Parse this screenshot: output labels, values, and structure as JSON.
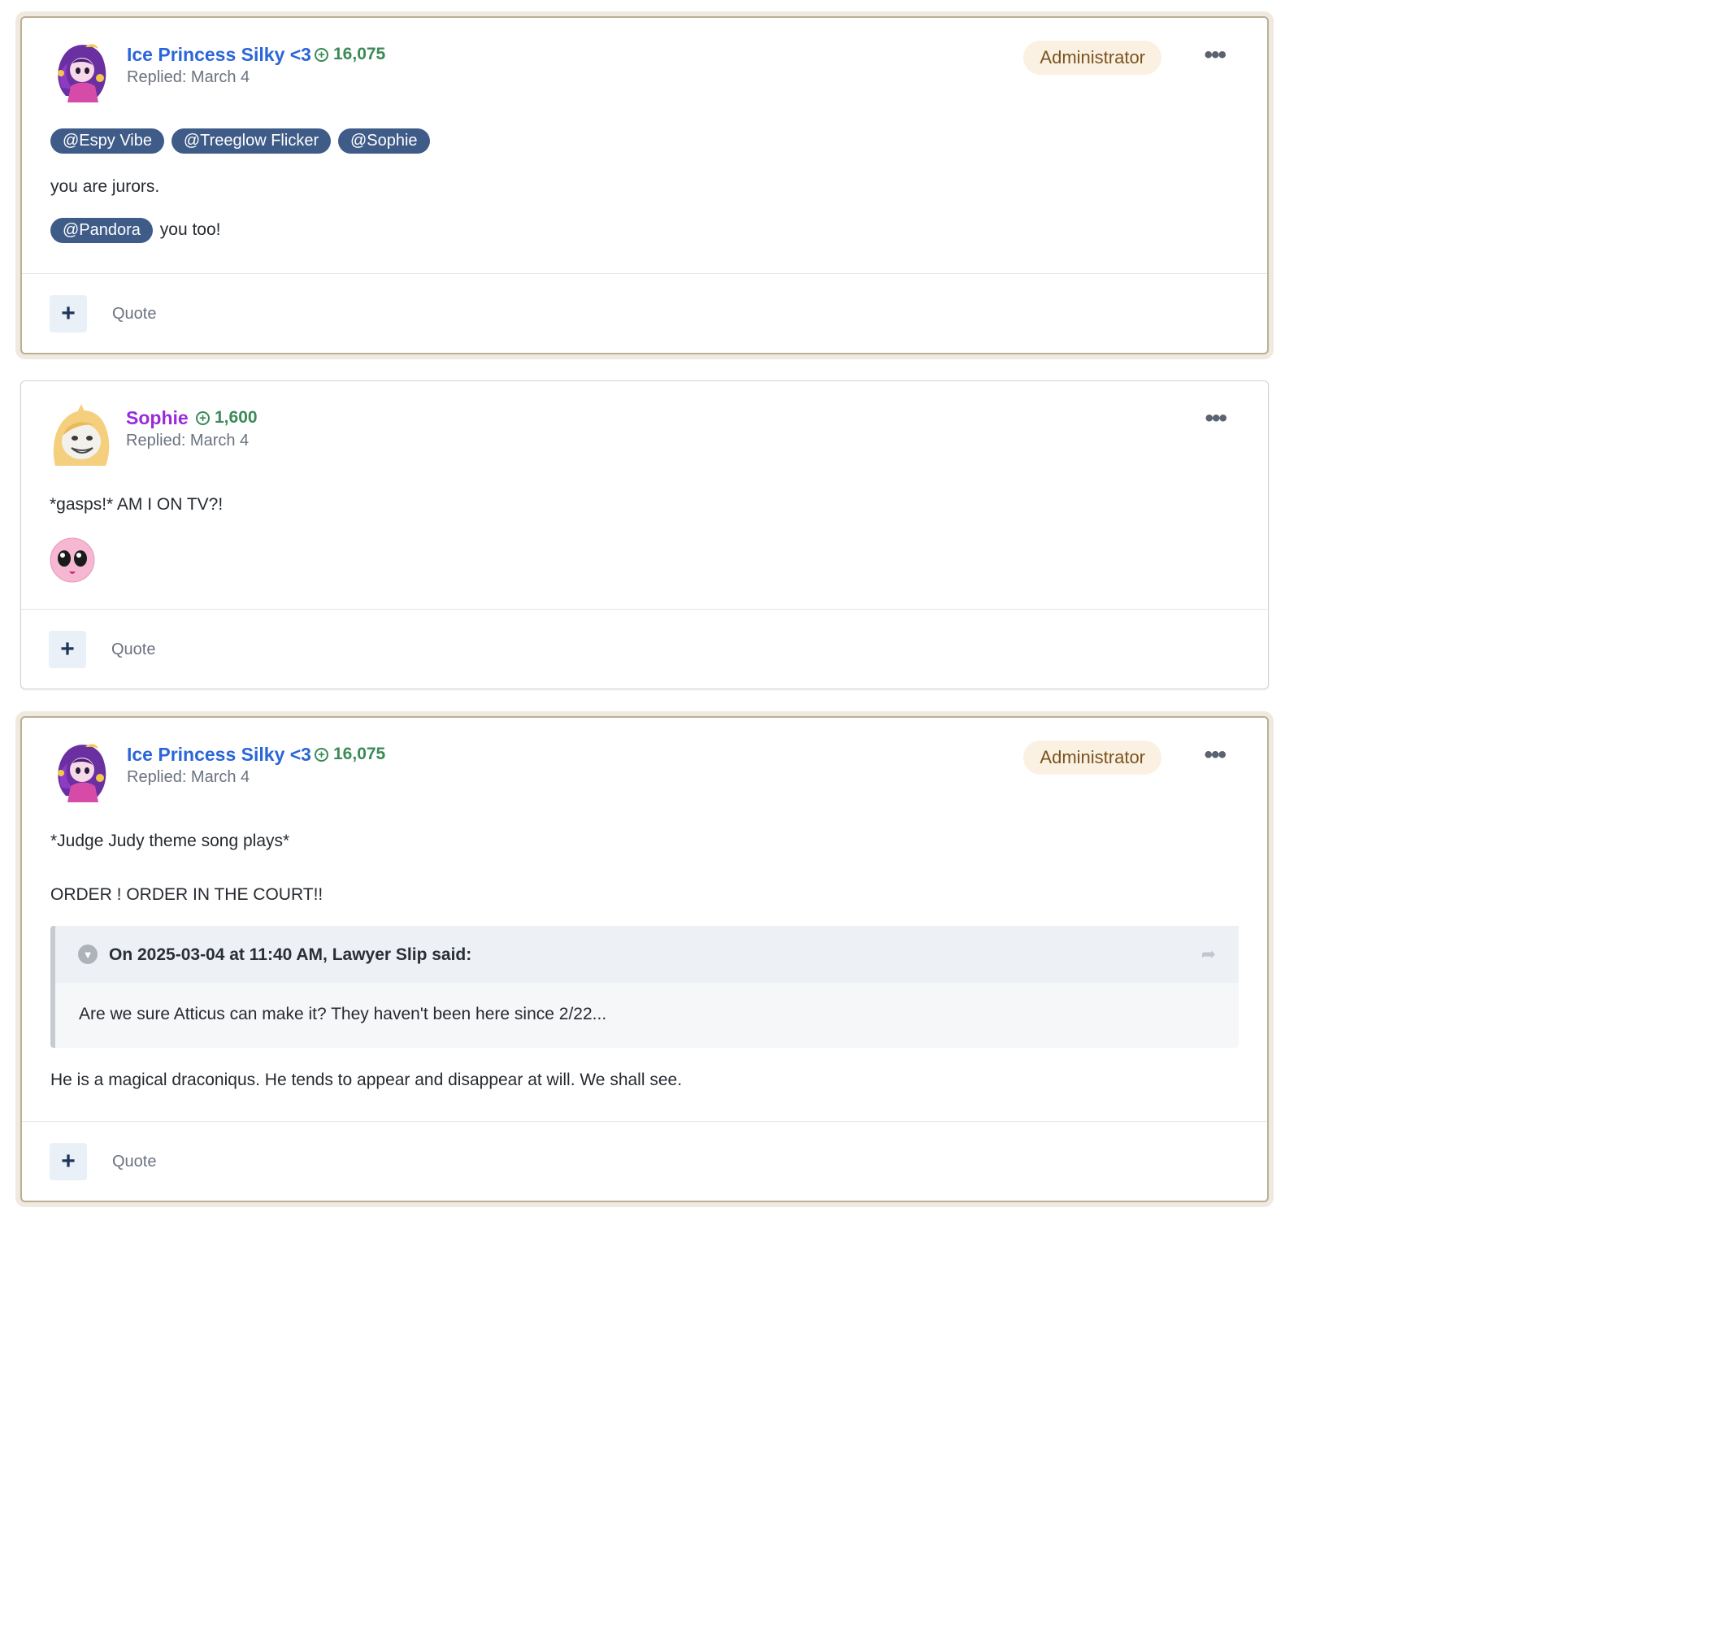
{
  "posts": [
    {
      "author": "Ice Princess Silky <3",
      "reputation": "16,075",
      "replied": "Replied: March 4",
      "badge": "Administrator",
      "mentions": [
        "@Espy Vibe",
        "@Treeglow Flicker",
        "@Sophie"
      ],
      "text1": "you are jurors.",
      "mention2": "@Pandora",
      "text2": "you too!",
      "quote_label": "Quote"
    },
    {
      "author": "Sophie",
      "reputation": "1,600",
      "replied": "Replied: March 4",
      "text1": "*gasps!* AM I ON TV?!",
      "quote_label": "Quote"
    },
    {
      "author": "Ice Princess Silky <3",
      "reputation": "16,075",
      "replied": "Replied: March 4",
      "badge": "Administrator",
      "text1": "*Judge Judy theme song plays*",
      "text2": "ORDER ! ORDER IN THE COURT!!",
      "quote": {
        "citation": "On 2025-03-04 at 11:40 AM, Lawyer Slip said:",
        "text": "Are we sure Atticus can make it? They haven't been here since 2/22..."
      },
      "text3": "He is a magical draconiqus. He tends to appear and disappear at will. We shall see.",
      "quote_label": "Quote"
    }
  ],
  "colors": {
    "author_blue": "#2a66d9",
    "author_purple": "#9b2bd9",
    "reputation_green": "#3b8a57",
    "mention_bg": "#3f5b87",
    "staff_border": "#bcae95"
  }
}
